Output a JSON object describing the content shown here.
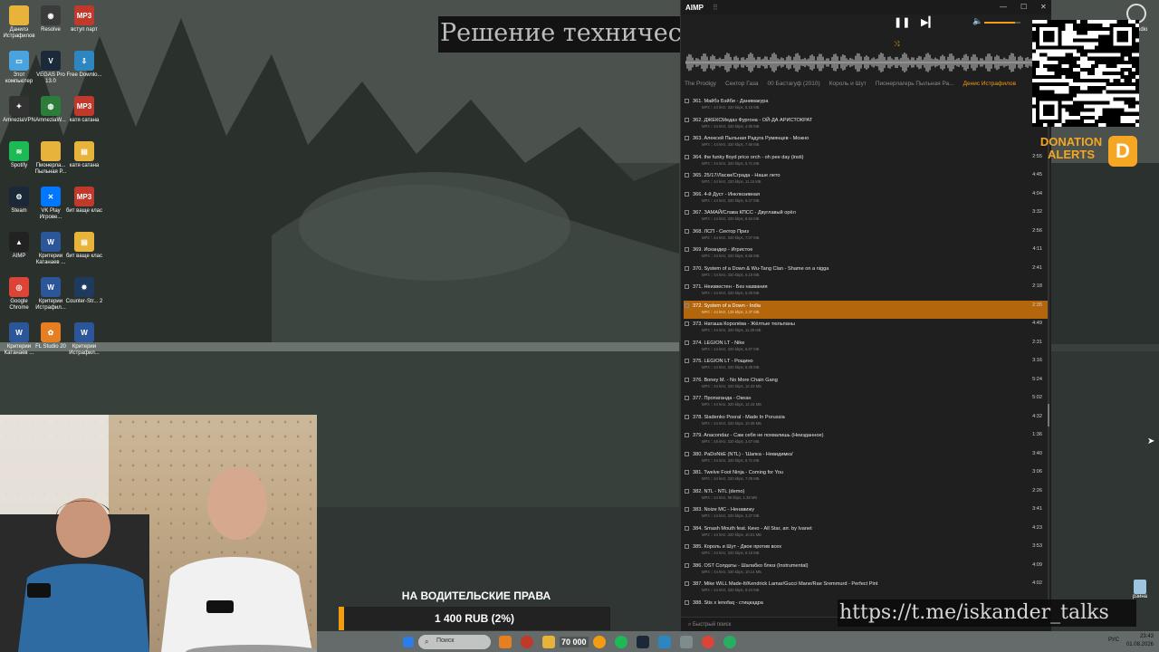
{
  "stream": {
    "title": "Решение технических решений",
    "telegram_link": "https://t.me/iskander_talks"
  },
  "desktop_icons": [
    {
      "label": "Данилэ Истрафилов",
      "icon": "folder-icon",
      "color": "#e8b33a",
      "glyph": ""
    },
    {
      "label": "Resolve",
      "icon": "davinci-resolve-icon",
      "color": "#3b3b3b",
      "glyph": "◉"
    },
    {
      "label": "вступ парт",
      "icon": "mp3-file-icon",
      "color": "#c0392b",
      "glyph": "MP3"
    },
    {
      "label": "Этот компьютер",
      "icon": "computer-icon",
      "color": "#4aa3df",
      "glyph": "▭"
    },
    {
      "label": "VEGAS Pro 13.0",
      "icon": "vegas-pro-icon",
      "color": "#1b2a3a",
      "glyph": "V"
    },
    {
      "label": "Free Downlo...",
      "icon": "download-manager-icon",
      "color": "#2e86c1",
      "glyph": "⇩"
    },
    {
      "label": "AmneziaVPN",
      "icon": "amnezia-vpn-icon",
      "color": "#333",
      "glyph": "✦"
    },
    {
      "label": "AmneziaW...",
      "icon": "amnezia-wg-icon",
      "color": "#2d7d3a",
      "glyph": "◍"
    },
    {
      "label": "катя сатана",
      "icon": "mp3-file-icon",
      "color": "#c0392b",
      "glyph": "MP3"
    },
    {
      "label": "Spotify",
      "icon": "spotify-icon",
      "color": "#1db954",
      "glyph": "≋"
    },
    {
      "label": "Пионерла... Пыльная Р...",
      "icon": "folder-icon",
      "color": "#e8b33a",
      "glyph": ""
    },
    {
      "label": "катя сатана",
      "icon": "archive-icon",
      "color": "#e8b33a",
      "glyph": "▤"
    },
    {
      "label": "Steam",
      "icon": "steam-icon",
      "color": "#1b2838",
      "glyph": "⚙"
    },
    {
      "label": "VK Play Игрове...",
      "icon": "vk-play-icon",
      "color": "#0077ff",
      "glyph": "✕"
    },
    {
      "label": "бит ваще клас",
      "icon": "mp3-file-icon",
      "color": "#c0392b",
      "glyph": "MP3"
    },
    {
      "label": "AIMP",
      "icon": "aimp-icon",
      "color": "#222",
      "glyph": "▲"
    },
    {
      "label": "Критерии Катанаев ...",
      "icon": "word-doc-icon",
      "color": "#2b579a",
      "glyph": "W"
    },
    {
      "label": "бит ваще клас",
      "icon": "archive-icon",
      "color": "#e8b33a",
      "glyph": "▤"
    },
    {
      "label": "Google Chrome",
      "icon": "chrome-icon",
      "color": "#db4437",
      "glyph": "◎"
    },
    {
      "label": "Критерии Истрафил...",
      "icon": "word-doc-icon",
      "color": "#2b579a",
      "glyph": "W"
    },
    {
      "label": "Counter-Str... 2",
      "icon": "cs2-icon",
      "color": "#1e3a5f",
      "glyph": "✸"
    },
    {
      "label": "Критерии Катанаев ...",
      "icon": "word-doc-icon",
      "color": "#2b579a",
      "glyph": "W"
    },
    {
      "label": "FL Studio 20",
      "icon": "fl-studio-icon",
      "color": "#e67e22",
      "glyph": "✿"
    },
    {
      "label": "Критерии Истрафил...",
      "icon": "word-doc-icon",
      "color": "#2b579a",
      "glyph": "W"
    }
  ],
  "aimp": {
    "logo_text": "AIMP",
    "tabs": [
      "The Prodigy",
      "Сектор Газа",
      "00 Бастагуф (2010)",
      "Король и Шут",
      "Пионерлагерь Пыльная Ра...",
      "Денис Истрафилов"
    ],
    "active_tab": 5,
    "filter_placeholder": "Быстрый поиск",
    "tracks": [
      {
        "title": "361. Майбэ Бэйби - Данимакура",
        "meta": "MP3 :: 44 kHz, 320 kbps, 8.18 МБ",
        "duration": ""
      },
      {
        "title": "362. ДЖЕКСМедаз Фургона - ОЙ-ДА АРИСТОКРАТ",
        "meta": "MP3 :: 44 kHz, 320 kbps, 4.95 МБ",
        "duration": ""
      },
      {
        "title": "363. Алексей Пыльная Радуга Румянцев - Можно",
        "meta": "MP3 :: 44 kHz, 320 kbps, 7.58 МБ",
        "duration": ""
      },
      {
        "title": "364. the funky floyd price orch - oh pee day (insti)",
        "meta": "MP3 :: 44 kHz, 320 kbps, 5.71 МБ",
        "duration": "2:55"
      },
      {
        "title": "365. 25/17/Ласки/Сграда - Наше лето",
        "meta": "MP3 :: 44 kHz, 320 kbps, 11.15 МБ",
        "duration": "4:45"
      },
      {
        "title": "366. 4-й Дуст - Инклюзивная",
        "meta": "MP3 :: 44 kHz, 320 kbps, 9.27 МБ",
        "duration": "4:04"
      },
      {
        "title": "367. ЗАМАЙ/Слава КПСС - Двуглавый орёл",
        "meta": "MP3 :: 44 kHz, 320 kbps, 8.64 МБ",
        "duration": "3:32"
      },
      {
        "title": "368. ЛСП - Сектор Приз",
        "meta": "MP3 :: 44 kHz, 320 kbps, 7.07 МБ",
        "duration": "2:56"
      },
      {
        "title": "369. Искандер - Игристое",
        "meta": "MP3 :: 44 kHz, 320 kbps, 9.55 МБ",
        "duration": "4:11"
      },
      {
        "title": "370. System of a Down & Wu-Tang Clan - Shame on a nigga",
        "meta": "MP3 :: 44 kHz, 320 kbps, 6.19 МБ",
        "duration": "2:41"
      },
      {
        "title": "371. Неизвестен - Без названия",
        "meta": "MP3 :: 44 kHz, 320 kbps, 5.26 МБ",
        "duration": "2:18"
      },
      {
        "title": "372. System of a Down - India",
        "meta": "MP3 :: 44 kHz, 128 kbps, 2.37 МБ",
        "duration": "2:35",
        "playing": true
      },
      {
        "title": "373. Наташа Королёва - Жёлтые тюльпаны",
        "meta": "MP3 :: 44 kHz, 320 kbps, 11.28 МБ",
        "duration": "4:49"
      },
      {
        "title": "374. LEGION LT - Nike",
        "meta": "MP3 :: 44 kHz, 320 kbps, 6.67 МБ",
        "duration": "2:31"
      },
      {
        "title": "375. LEGION LT - Рощино",
        "meta": "MP3 :: 44 kHz, 320 kbps, 8.49 МБ",
        "duration": "3:16"
      },
      {
        "title": "376. Boney M. - No More Chain Gang",
        "meta": "MP3 :: 44 kHz, 320 kbps, 12.33 МБ",
        "duration": "5:24"
      },
      {
        "title": "377. Пропаганда - Океан",
        "meta": "MP3 :: 44 kHz, 320 kbps, 12.15 МБ",
        "duration": "5:02"
      },
      {
        "title": "378. Sladenko Posral - Made In Porussia",
        "meta": "MP3 :: 44 kHz, 320 kbps, 10.35 МБ",
        "duration": "4:32"
      },
      {
        "title": "379. Anacondaz - Сам себя не похвалишь (Неизданное)",
        "meta": "MP3 :: 48 kHz, 320 kbps, 3.67 МБ",
        "duration": "1:36"
      },
      {
        "title": "380. PaDoNkE (NTL) - 'Шапка - Невидимка'",
        "meta": "MP3 :: 44 kHz, 320 kbps, 8.71 МБ",
        "duration": "3:40"
      },
      {
        "title": "381. Twelve Foot Ninja - Coming for You",
        "meta": "MP3 :: 44 kHz, 320 kbps, 7.09 МБ",
        "duration": "3:06"
      },
      {
        "title": "382. NTL - NTL (demo)",
        "meta": "MP3 :: 44 kHz, 96 kbps, 1.36 МБ",
        "duration": "2:26"
      },
      {
        "title": "383. Noize MC - Ненавижу",
        "meta": "MP3 :: 44 kHz, 320 kbps, 3.27 МБ",
        "duration": "3:41"
      },
      {
        "title": "384. Smash Mouth feat. Кино - All Star, arr. by Ivanet",
        "meta": "MP3 :: 44 kHz, 320 kbps, 10.01 МБ",
        "duration": "4:23"
      },
      {
        "title": "385. Король и Шут - Двое против всех",
        "meta": "MP3 :: 44 kHz, 320 kbps, 8.18 МБ",
        "duration": "3:53"
      },
      {
        "title": "386. OST Солдаты - Шалабко блюз (Instrumental)",
        "meta": "MP3 :: 44 kHz, 320 kbps, 10.14 МБ",
        "duration": "4:09"
      },
      {
        "title": "387. Mike WiLL Made-It/Kendrick Lamar/Gucci Mane/Rae Sremmurd - Perfect Pint",
        "meta": "MP3 :: 44 kHz, 320 kbps, 9.24 МБ",
        "duration": "4:02"
      },
      {
        "title": "388. Stis x lenofaq - стицкадра",
        "meta": "",
        "duration": ""
      }
    ]
  },
  "donation": {
    "brand_line1": "DONATION",
    "brand_line2": "ALERTS",
    "logo_letter": "D"
  },
  "corner": {
    "label": "udio"
  },
  "recycle": {
    "label": "рзина"
  },
  "goal": {
    "title": "НА ВОДИТЕЛЬСКИЕ ПРАВА",
    "amount_text": "1 400 RUB (2%)",
    "progress": 0.02
  },
  "taskbar": {
    "search_placeholder": "Поиск",
    "counter": "70 000",
    "lang": "РУС",
    "time": "23:43",
    "date": "01.08.2026"
  },
  "colors": {
    "accent": "#f39c12",
    "playing_row": "#b3660b"
  }
}
